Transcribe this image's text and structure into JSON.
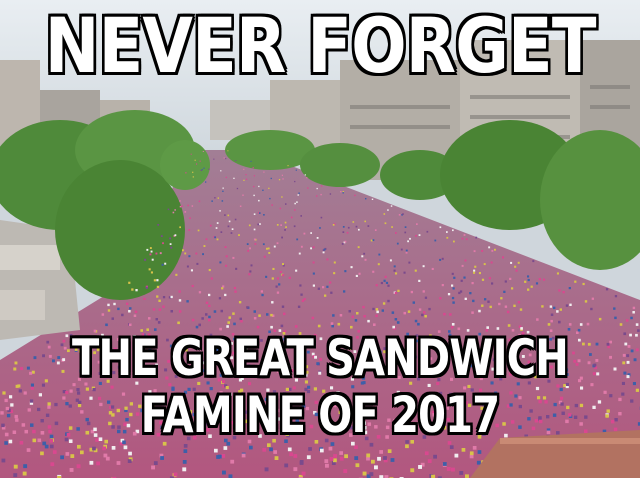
{
  "meme": {
    "top_text": "NEVER FORGET",
    "bottom_line_1": "THE GREAT SANDWICH",
    "bottom_line_2": "FAMINE OF 2017"
  },
  "scene": {
    "subject": "crowd-filled-avenue",
    "colors": {
      "sky": "#dfe5ea",
      "buildings": "#b7b3ad",
      "trees": "#4f8a3a",
      "crowd_pink": "#d9488f",
      "crowd_purple": "#7a4a8c",
      "crowd_white": "#f1eef0",
      "crowd_yellow": "#d8c24a"
    }
  }
}
